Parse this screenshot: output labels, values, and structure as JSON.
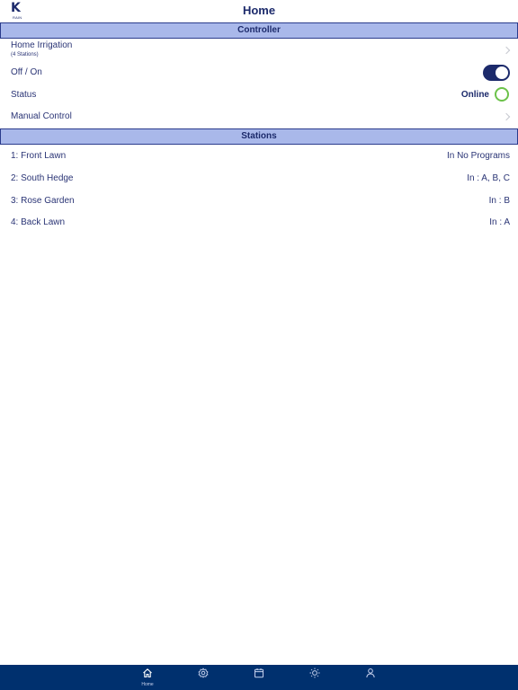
{
  "header": {
    "logo_letter": "K",
    "logo_text": "RAIN",
    "title": "Home"
  },
  "controller_section": {
    "title": "Controller",
    "name": "Home Irrigation",
    "stations_count": "(4 Stations)",
    "power_label": "Off / On",
    "power_on": true,
    "status_label": "Status",
    "status_value": "Online",
    "manual_label": "Manual Control"
  },
  "stations_section": {
    "title": "Stations",
    "items": [
      {
        "name": "1: Front Lawn",
        "programs": "In No Programs"
      },
      {
        "name": "2: South Hedge",
        "programs": "In : A, B, C"
      },
      {
        "name": "3: Rose Garden",
        "programs": "In : B"
      },
      {
        "name": "4: Back Lawn",
        "programs": "In : A"
      }
    ]
  },
  "tabbar": {
    "home_label": "Home",
    "icons": [
      "home-icon",
      "gear-icon",
      "calendar-icon",
      "sun-icon",
      "person-icon"
    ]
  },
  "colors": {
    "brand": "#1c2a6b",
    "section_bg": "#a9b8ea",
    "tabbar_bg": "#00306e",
    "online": "#6cc24a"
  }
}
